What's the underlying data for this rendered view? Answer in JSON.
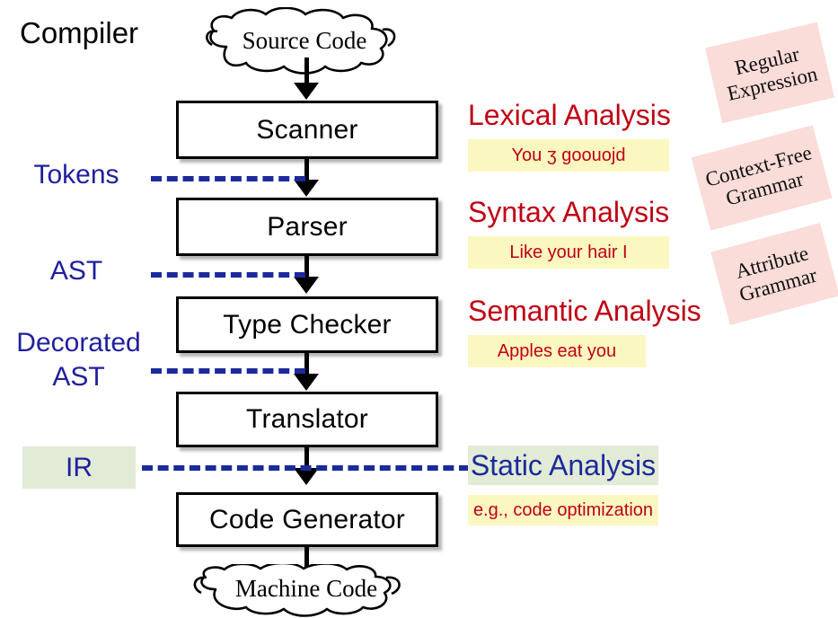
{
  "diagram": {
    "title": "Compiler",
    "type": "flowchart",
    "description": "Compiler pipeline flowchart: source code flows through five stages to machine code, with intermediate representations labeled on the left and analysis phases plus formal-method tags on the right."
  },
  "colors": {
    "stage_border": "#000000",
    "stage_fill": "#ffffff",
    "data_label_blue": "#1f1f9e",
    "dashed_blue": "#1b2a9c",
    "phase_red": "#c00014",
    "yellow_highlight": "#fbf7c0",
    "green_highlight": "#e2ebd5",
    "pink_tag": "#fadcd9"
  },
  "input_cloud": {
    "label": "Source Code",
    "icon": "cloud-icon"
  },
  "output_cloud": {
    "label": "Machine Code",
    "icon": "cloud-icon"
  },
  "stages": [
    {
      "label": "Scanner"
    },
    {
      "label": "Parser"
    },
    {
      "label": "Type Checker"
    },
    {
      "label": "Translator"
    },
    {
      "label": "Code Generator"
    }
  ],
  "data_labels": [
    {
      "label": "Tokens",
      "highlight": false
    },
    {
      "label": "AST",
      "highlight": false
    },
    {
      "label": "Decorated\nAST",
      "line1": "Decorated",
      "line2": "AST",
      "highlight": false
    },
    {
      "label": "IR",
      "highlight": true
    }
  ],
  "phases": [
    {
      "label": "Lexical Analysis",
      "color": "red",
      "example": "You ʒ goouojd"
    },
    {
      "label": "Syntax Analysis",
      "color": "red",
      "example": "Like your hair I"
    },
    {
      "label": "Semantic Analysis",
      "color": "red",
      "example": "Apples eat you"
    },
    {
      "label": "Static Analysis",
      "color": "blue",
      "example": "e.g., code optimization"
    }
  ],
  "formalism_tags": [
    {
      "line1": "Regular",
      "line2": "Expression"
    },
    {
      "line1": "Context-Free",
      "line2": "Grammar"
    },
    {
      "line1": "Attribute",
      "line2": "Grammar"
    }
  ]
}
